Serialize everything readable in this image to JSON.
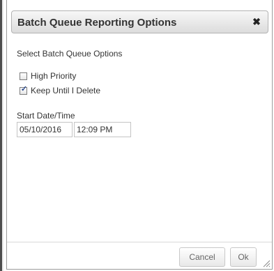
{
  "dialog": {
    "title": "Batch Queue Reporting Options",
    "close_icon": "close-icon",
    "section_label": "Select Batch Queue Options",
    "options": [
      {
        "label": "High Priority",
        "checked": false
      },
      {
        "label": "Keep Until I Delete",
        "checked": true
      }
    ],
    "start_label": "Start Date/Time",
    "date_value": "05/10/2016",
    "time_value": "12:09 PM",
    "buttons": {
      "cancel": "Cancel",
      "ok": "Ok"
    },
    "colors": {
      "title_text": "#333333",
      "checkmark": "#2b4a8c",
      "border": "#9a9a9a"
    }
  }
}
